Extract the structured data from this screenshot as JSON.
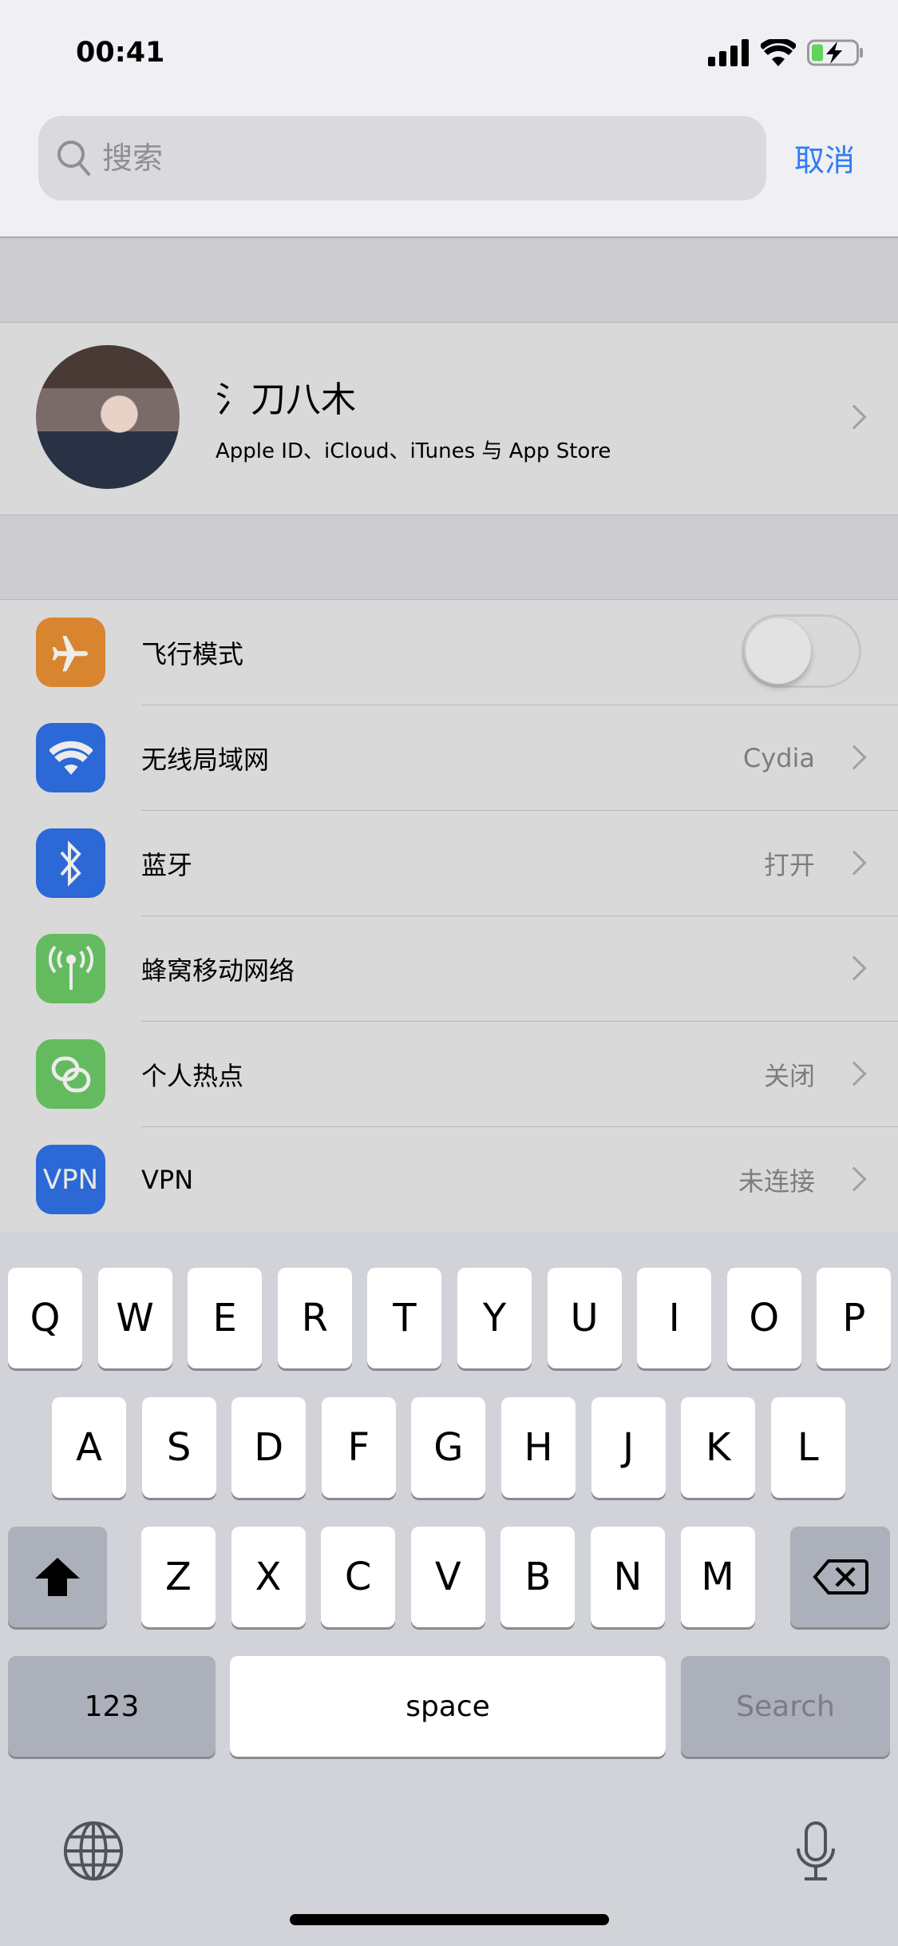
{
  "status": {
    "time": "00:41",
    "icons": [
      "signal-icon",
      "wifi-icon",
      "battery-charging-icon"
    ]
  },
  "search": {
    "placeholder": "搜索",
    "cancel": "取消"
  },
  "profile": {
    "name": "氵刀八木",
    "subtitle": "Apple ID、iCloud、iTunes 与 App Store"
  },
  "rows": [
    {
      "label": "飞行模式",
      "icon": "airplane-icon",
      "color": "#d9852f",
      "toggle": false
    },
    {
      "label": "无线局域网",
      "icon": "wifi-icon",
      "color": "#2c68d6",
      "value": "Cydia"
    },
    {
      "label": "蓝牙",
      "icon": "bluetooth-icon",
      "color": "#2c68d6",
      "value": "打开"
    },
    {
      "label": "蜂窝移动网络",
      "icon": "antenna-icon",
      "color": "#64bb5f",
      "value": ""
    },
    {
      "label": "个人热点",
      "icon": "hotspot-icon",
      "color": "#64bb5f",
      "value": "关闭"
    },
    {
      "label": "VPN",
      "icon": "vpn-icon",
      "icon_text": "VPN",
      "color": "#2c68d6",
      "value": "未连接"
    }
  ],
  "keyboard": {
    "row1": [
      "Q",
      "W",
      "E",
      "R",
      "T",
      "Y",
      "U",
      "I",
      "O",
      "P"
    ],
    "row2": [
      "A",
      "S",
      "D",
      "F",
      "G",
      "H",
      "J",
      "K",
      "L"
    ],
    "row3": [
      "Z",
      "X",
      "C",
      "V",
      "B",
      "N",
      "M"
    ],
    "numbers": "123",
    "space": "space",
    "search": "Search"
  }
}
